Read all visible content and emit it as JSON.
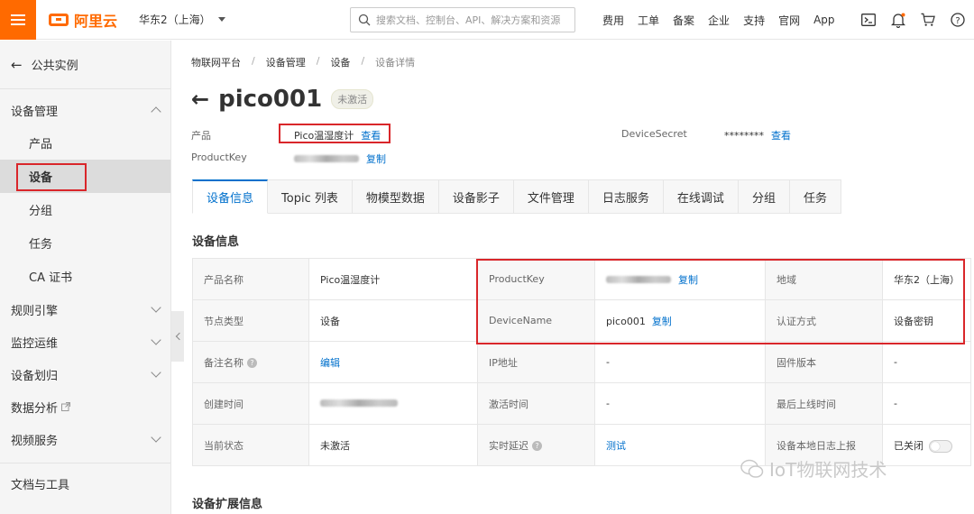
{
  "topbar": {
    "brand": "阿里云",
    "region": "华东2（上海）",
    "search_placeholder": "搜索文档、控制台、API、解决方案和资源",
    "links": [
      "费用",
      "工单",
      "备案",
      "企业",
      "支持",
      "官网",
      "App"
    ],
    "icons": [
      "terminal-icon",
      "bell-icon",
      "cart-icon",
      "help-icon"
    ],
    "brand_color": "#ff6a00"
  },
  "sidebar": {
    "back_label": "公共实例",
    "device_mgmt": "设备管理",
    "device_items": [
      "产品",
      "设备",
      "分组",
      "任务",
      "CA 证书"
    ],
    "active_item": "设备",
    "groups": [
      "规则引擎",
      "监控运维",
      "设备划归",
      "数据分析",
      "视频服务"
    ],
    "bottom": "文档与工具"
  },
  "breadcrumb": [
    "物联网平台",
    "设备管理",
    "设备",
    "设备详情"
  ],
  "device": {
    "name": "pico001",
    "status": "未激活",
    "product_label": "产品",
    "product_value": "Pico温湿度计",
    "view_label": "查看",
    "productkey_label": "ProductKey",
    "copy_label": "复制",
    "secret_label": "DeviceSecret",
    "secret_value": "********"
  },
  "tabs": [
    "设备信息",
    "Topic 列表",
    "物模型数据",
    "设备影子",
    "文件管理",
    "日志服务",
    "在线调试",
    "分组",
    "任务"
  ],
  "active_tab": "设备信息",
  "info_section_title": "设备信息",
  "info_rows": [
    {
      "l1": "产品名称",
      "v1": "Pico温湿度计",
      "l2": "ProductKey",
      "v2": "",
      "v2link": "复制",
      "l3": "地域",
      "v3": "华东2（上海）"
    },
    {
      "l1": "节点类型",
      "v1": "设备",
      "l2": "DeviceName",
      "v2": "pico001",
      "v2link": "复制",
      "l3": "认证方式",
      "v3": "设备密钥"
    },
    {
      "l1": "备注名称",
      "v1": "编辑",
      "l2": "IP地址",
      "v2": "-",
      "l3": "固件版本",
      "v3": "-"
    },
    {
      "l1": "创建时间",
      "v1": "",
      "l2": "激活时间",
      "v2": "-",
      "l3": "最后上线时间",
      "v3": "-"
    },
    {
      "l1": "当前状态",
      "v1": "未激活",
      "l2": "实时延迟",
      "v2": "测试",
      "l3": "设备本地日志上报",
      "v3": "已关闭"
    }
  ],
  "ext_section_title": "设备扩展信息",
  "watermark": "IoT物联网技术"
}
